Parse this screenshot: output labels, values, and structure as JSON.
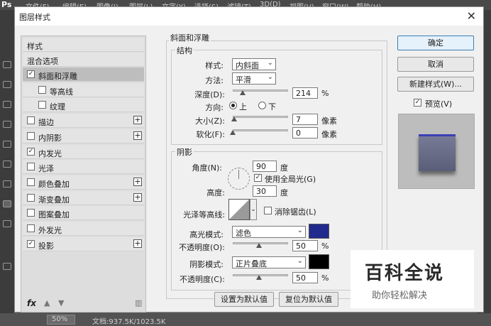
{
  "app": {
    "logo": "Ps",
    "menus": [
      "文件(F)",
      "编辑(E)",
      "图像(I)",
      "图层(L)",
      "文字(Y)",
      "选择(S)",
      "滤镜(T)",
      "3D(D)",
      "视图(V)",
      "窗口(W)",
      "帮助(H)"
    ],
    "zoom": "50%",
    "doc_info": "文档:937.5K/1023.5K"
  },
  "dialog": {
    "title": "图层样式",
    "close": "✕"
  },
  "styles_panel": {
    "header": "样式",
    "blend_options": "混合选项",
    "items": [
      {
        "label": "斜面和浮雕",
        "checked": true,
        "selected": true,
        "has_plus": false
      },
      {
        "label": "等高线",
        "checked": false,
        "selected": false,
        "has_plus": false
      },
      {
        "label": "纹理",
        "checked": false,
        "selected": false,
        "has_plus": false
      },
      {
        "label": "描边",
        "checked": false,
        "selected": false,
        "has_plus": true
      },
      {
        "label": "内阴影",
        "checked": false,
        "selected": false,
        "has_plus": true
      },
      {
        "label": "内发光",
        "checked": true,
        "selected": false,
        "has_plus": false
      },
      {
        "label": "光泽",
        "checked": false,
        "selected": false,
        "has_plus": false
      },
      {
        "label": "颜色叠加",
        "checked": false,
        "selected": false,
        "has_plus": true
      },
      {
        "label": "渐变叠加",
        "checked": false,
        "selected": false,
        "has_plus": true
      },
      {
        "label": "图案叠加",
        "checked": false,
        "selected": false,
        "has_plus": false
      },
      {
        "label": "外发光",
        "checked": false,
        "selected": false,
        "has_plus": false
      },
      {
        "label": "投影",
        "checked": true,
        "selected": false,
        "has_plus": true
      }
    ],
    "footer_fx": "fx",
    "check_mark": "✓",
    "plus_sign": "+"
  },
  "bevel": {
    "section_title": "斜面和浮雕",
    "structure_title": "结构",
    "style_label": "样式:",
    "style_value": "内斜面",
    "method_label": "方法:",
    "method_value": "平滑",
    "depth_label": "深度(D):",
    "depth_value": "214",
    "depth_unit": "%",
    "direction_label": "方向:",
    "direction_up": "上",
    "direction_down": "下",
    "size_label": "大小(Z):",
    "size_value": "7",
    "size_unit": "像素",
    "soften_label": "软化(F):",
    "soften_value": "0",
    "soften_unit": "像素"
  },
  "shading": {
    "title": "阴影",
    "angle_label": "角度(N):",
    "angle_value": "90",
    "angle_unit": "度",
    "global_light_label": "使用全局光(G)",
    "altitude_label": "高度:",
    "altitude_value": "30",
    "altitude_unit": "度",
    "gloss_label": "光泽等高线:",
    "antialias_label": "消除锯齿(L)",
    "highlight_mode_label": "高光模式:",
    "highlight_mode_value": "滤色",
    "highlight_color": "#1f2a8c",
    "highlight_opacity_label": "不透明度(O):",
    "highlight_opacity_value": "50",
    "shadow_mode_label": "阴影模式:",
    "shadow_mode_value": "正片叠底",
    "shadow_color": "#000000",
    "shadow_opacity_label": "不透明度(C):",
    "shadow_opacity_value": "50",
    "percent": "%"
  },
  "buttons": {
    "make_default": "设置为默认值",
    "reset_default": "复位为默认值",
    "ok": "确定",
    "cancel": "取消",
    "new_style": "新建样式(W)...",
    "preview_label": "预览(V)"
  },
  "watermark": {
    "big": "百科全说",
    "small": "助你轻松解决"
  }
}
